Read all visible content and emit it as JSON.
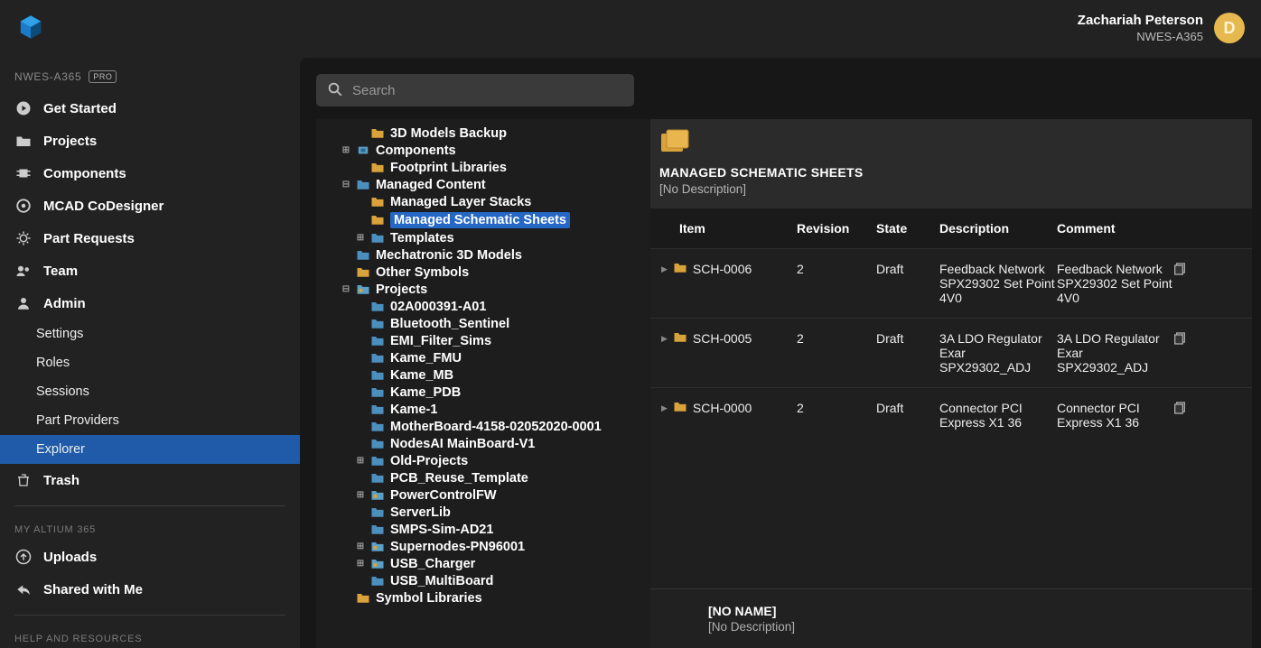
{
  "header": {
    "user_name": "Zachariah Peterson",
    "workspace": "NWES-A365",
    "avatar_initial": "D"
  },
  "sidebar": {
    "workspace_label": "NWES-A365",
    "pro_badge": "PRO",
    "items": [
      {
        "label": "Get Started",
        "icon": "play"
      },
      {
        "label": "Projects",
        "icon": "folder"
      },
      {
        "label": "Components",
        "icon": "chip"
      },
      {
        "label": "MCAD CoDesigner",
        "icon": "codesign"
      },
      {
        "label": "Part Requests",
        "icon": "gear"
      },
      {
        "label": "Team",
        "icon": "team"
      },
      {
        "label": "Admin",
        "icon": "admin"
      }
    ],
    "admin_sub": [
      {
        "label": "Settings"
      },
      {
        "label": "Roles"
      },
      {
        "label": "Sessions"
      },
      {
        "label": "Part Providers"
      },
      {
        "label": "Explorer",
        "active": true
      },
      {
        "label": "Trash",
        "icon": "trash"
      }
    ],
    "section2_label": "MY ALTIUM 365",
    "section2_items": [
      {
        "label": "Uploads",
        "icon": "upload"
      },
      {
        "label": "Shared with Me",
        "icon": "share"
      }
    ],
    "section3_label": "HELP AND RESOURCES",
    "search_placeholder": "Search"
  },
  "tree": [
    {
      "label": "3D Models Backup",
      "icon": "yellow",
      "depth": 2,
      "exp": ""
    },
    {
      "label": "Components",
      "icon": "comp",
      "depth": 1,
      "exp": "+"
    },
    {
      "label": "Footprint Libraries",
      "icon": "yellow",
      "depth": 2,
      "exp": ""
    },
    {
      "label": "Managed Content",
      "icon": "blue",
      "depth": 1,
      "exp": "-"
    },
    {
      "label": "Managed Layer Stacks",
      "icon": "yellow",
      "depth": 2,
      "exp": ""
    },
    {
      "label": "Managed Schematic Sheets",
      "icon": "yellow",
      "depth": 2,
      "exp": "",
      "selected": true
    },
    {
      "label": "Templates",
      "icon": "blue",
      "depth": 2,
      "exp": "+"
    },
    {
      "label": "Mechatronic 3D Models",
      "icon": "blue",
      "depth": 1,
      "exp": ""
    },
    {
      "label": "Other Symbols",
      "icon": "yellow",
      "depth": 1,
      "exp": ""
    },
    {
      "label": "Projects",
      "icon": "proj",
      "depth": 1,
      "exp": "-"
    },
    {
      "label": "02A000391-A01",
      "icon": "blue",
      "depth": 2,
      "exp": ""
    },
    {
      "label": "Bluetooth_Sentinel",
      "icon": "blue",
      "depth": 2,
      "exp": ""
    },
    {
      "label": "EMI_Filter_Sims",
      "icon": "blue",
      "depth": 2,
      "exp": ""
    },
    {
      "label": "Kame_FMU",
      "icon": "blue",
      "depth": 2,
      "exp": ""
    },
    {
      "label": "Kame_MB",
      "icon": "blue",
      "depth": 2,
      "exp": ""
    },
    {
      "label": "Kame_PDB",
      "icon": "blue",
      "depth": 2,
      "exp": ""
    },
    {
      "label": "Kame-1",
      "icon": "blue",
      "depth": 2,
      "exp": ""
    },
    {
      "label": "MotherBoard-4158-02052020-0001",
      "icon": "blue",
      "depth": 2,
      "exp": ""
    },
    {
      "label": "NodesAI MainBoard-V1",
      "icon": "blue",
      "depth": 2,
      "exp": ""
    },
    {
      "label": "Old-Projects",
      "icon": "blue",
      "depth": 2,
      "exp": "+"
    },
    {
      "label": "PCB_Reuse_Template",
      "icon": "blue",
      "depth": 2,
      "exp": ""
    },
    {
      "label": "PowerControlFW",
      "icon": "proj",
      "depth": 2,
      "exp": "+"
    },
    {
      "label": "ServerLib",
      "icon": "blue",
      "depth": 2,
      "exp": ""
    },
    {
      "label": "SMPS-Sim-AD21",
      "icon": "blue",
      "depth": 2,
      "exp": ""
    },
    {
      "label": "Supernodes-PN96001",
      "icon": "proj",
      "depth": 2,
      "exp": "+"
    },
    {
      "label": "USB_Charger",
      "icon": "proj",
      "depth": 2,
      "exp": "+"
    },
    {
      "label": "USB_MultiBoard",
      "icon": "blue",
      "depth": 2,
      "exp": ""
    },
    {
      "label": "Symbol Libraries",
      "icon": "yellow",
      "depth": 1,
      "exp": ""
    }
  ],
  "detail": {
    "title": "MANAGED SCHEMATIC SHEETS",
    "description": "[No Description]",
    "columns": {
      "item": "Item",
      "revision": "Revision",
      "state": "State",
      "description": "Description",
      "comment": "Comment"
    },
    "rows": [
      {
        "item": "SCH-0006",
        "revision": "2",
        "state": "Draft",
        "description": "Feedback Network SPX29302 Set Point 4V0",
        "comment": "Feedback Network SPX29302 Set Point 4V0"
      },
      {
        "item": "SCH-0005",
        "revision": "2",
        "state": "Draft",
        "description": "3A LDO Regulator Exar SPX29302_ADJ",
        "comment": "3A LDO Regulator Exar SPX29302_ADJ"
      },
      {
        "item": "SCH-0000",
        "revision": "2",
        "state": "Draft",
        "description": "Connector PCI Express X1 36",
        "comment": "Connector PCI Express X1 36"
      }
    ],
    "bottom": {
      "title": "[NO NAME]",
      "description": "[No Description]"
    }
  }
}
